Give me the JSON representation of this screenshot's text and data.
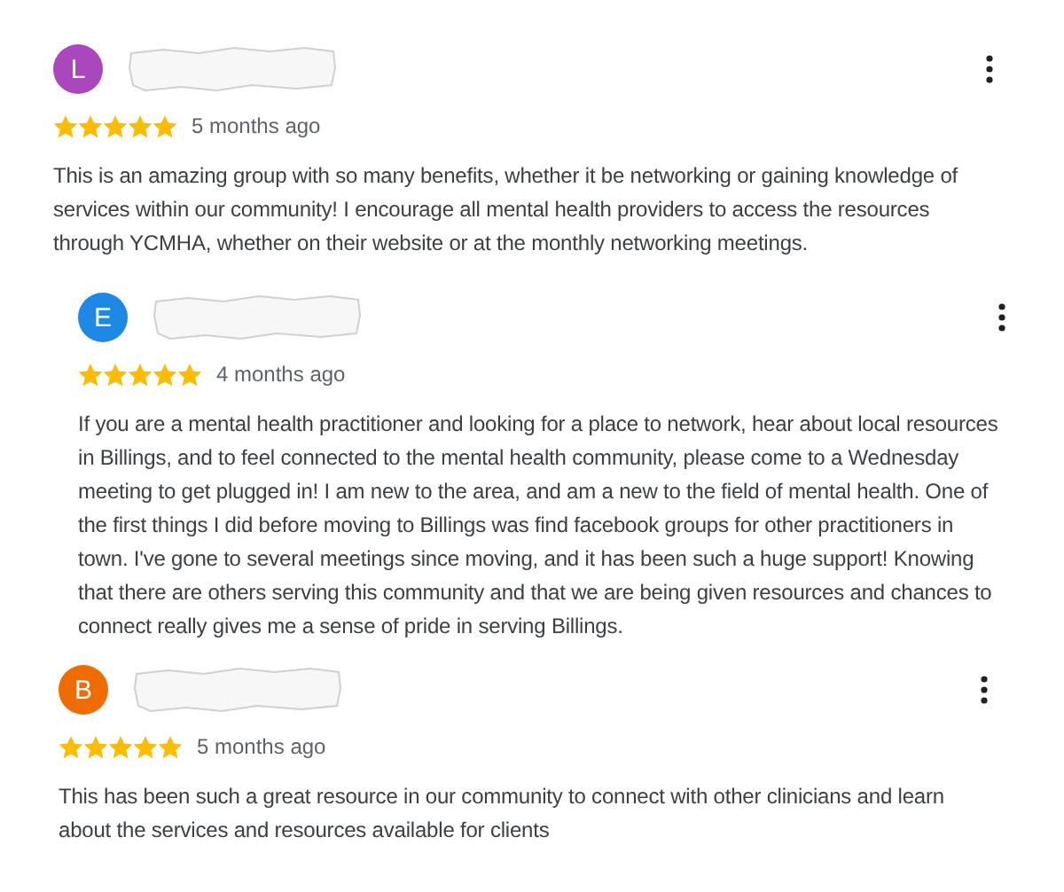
{
  "reviews": [
    {
      "initial": "L",
      "color": "#ab47bc",
      "stars": 5,
      "time": "5 months ago",
      "text": "This is an amazing group with so many benefits, whether it be networking or gaining knowledge of services within our community! I encourage all mental health providers to access the resources through YCMHA, whether on their website or at the monthly networking meetings."
    },
    {
      "initial": "E",
      "color": "#1e88e5",
      "stars": 5,
      "time": "4 months ago",
      "text": "If you are a mental health practitioner and looking for a place to network, hear about local resources in Billings, and to feel connected to the mental health community, please come to a Wednesday meeting to get plugged in! I am new to the area, and am a new to the field of mental health. One of the first things I did before moving to Billings was find facebook groups for other practitioners in town. I've gone to several meetings since moving, and it has been such a huge support! Knowing that there are others serving this community and that we are being given resources and chances to connect really gives me a sense of pride in serving Billings."
    },
    {
      "initial": "B",
      "color": "#ef6c00",
      "stars": 5,
      "time": "5 months ago",
      "text": "This has been such a great resource in our community to connect with other clinicians and learn about the services and resources available for clients"
    }
  ]
}
